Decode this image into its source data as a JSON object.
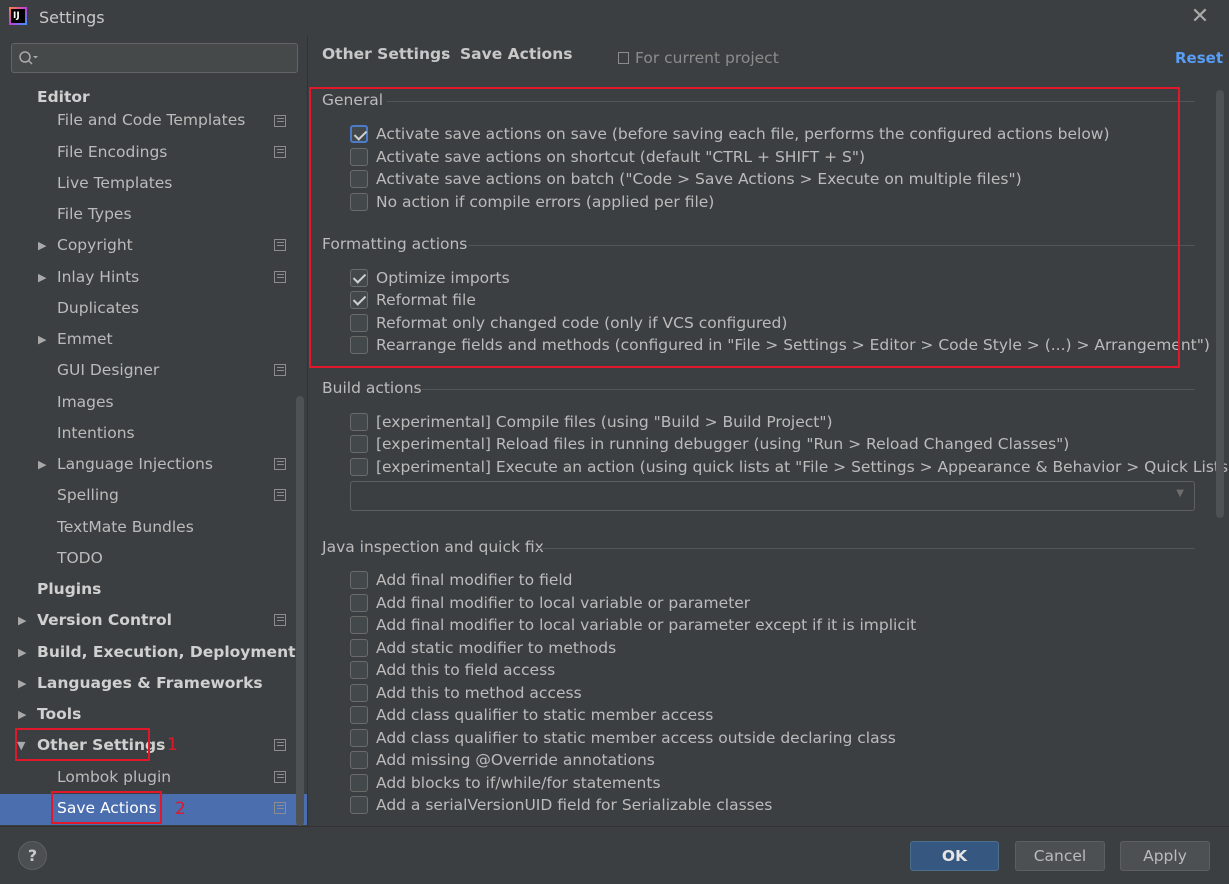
{
  "window": {
    "title": "Settings",
    "logo_text": "IJ"
  },
  "sidebar": {
    "items": [
      {
        "label": "Editor"
      },
      {
        "label": "File and Code Templates"
      },
      {
        "label": "File Encodings"
      },
      {
        "label": "Live Templates"
      },
      {
        "label": "File Types"
      },
      {
        "label": "Copyright"
      },
      {
        "label": "Inlay Hints"
      },
      {
        "label": "Duplicates"
      },
      {
        "label": "Emmet"
      },
      {
        "label": "GUI Designer"
      },
      {
        "label": "Images"
      },
      {
        "label": "Intentions"
      },
      {
        "label": "Language Injections"
      },
      {
        "label": "Spelling"
      },
      {
        "label": "TextMate Bundles"
      },
      {
        "label": "TODO"
      },
      {
        "label": "Plugins"
      },
      {
        "label": "Version Control"
      },
      {
        "label": "Build, Execution, Deployment"
      },
      {
        "label": "Languages & Frameworks"
      },
      {
        "label": "Tools"
      },
      {
        "label": "Other Settings"
      },
      {
        "label": "Lombok plugin"
      },
      {
        "label": "Save Actions"
      }
    ],
    "annotation_1": "1",
    "annotation_2": "2"
  },
  "header": {
    "breadcrumb_parent": "Other Settings",
    "breadcrumb_sep": "›",
    "breadcrumb_current": "Save Actions",
    "scope": "For current project",
    "reset": "Reset"
  },
  "general": {
    "title": "General",
    "options": [
      {
        "label": "Activate save actions on save (before saving each file, performs the configured actions below)",
        "checked": true
      },
      {
        "label": "Activate save actions on shortcut (default \"CTRL + SHIFT + S\")",
        "checked": false
      },
      {
        "label": "Activate save actions on batch (\"Code > Save Actions > Execute on multiple files\")",
        "checked": false
      },
      {
        "label": "No action if compile errors (applied per file)",
        "checked": false
      }
    ]
  },
  "formatting": {
    "title": "Formatting actions",
    "options": [
      {
        "label": "Optimize imports",
        "checked": true
      },
      {
        "label": "Reformat file",
        "checked": true
      },
      {
        "label": "Reformat only changed code (only if VCS configured)",
        "checked": false
      },
      {
        "label": "Rearrange fields and methods (configured in \"File > Settings > Editor > Code Style > (...) > Arrangement\")",
        "checked": false
      }
    ]
  },
  "build": {
    "title": "Build actions",
    "options": [
      {
        "label": "[experimental] Compile files (using \"Build > Build Project\")",
        "checked": false
      },
      {
        "label": "[experimental] Reload files in running debugger (using \"Run > Reload Changed Classes\")",
        "checked": false
      },
      {
        "label": "[experimental] Execute an action (using quick lists at \"File > Settings > Appearance & Behavior > Quick Lists\")",
        "checked": false
      }
    ],
    "combo_value": ""
  },
  "java": {
    "title": "Java inspection and quick fix",
    "options": [
      {
        "label": "Add final modifier to field",
        "checked": false
      },
      {
        "label": "Add final modifier to local variable or parameter",
        "checked": false
      },
      {
        "label": "Add final modifier to local variable or parameter except if it is implicit",
        "checked": false
      },
      {
        "label": "Add static modifier to methods",
        "checked": false
      },
      {
        "label": "Add this to field access",
        "checked": false
      },
      {
        "label": "Add this to method access",
        "checked": false
      },
      {
        "label": "Add class qualifier to static member access",
        "checked": false
      },
      {
        "label": "Add class qualifier to static member access outside declaring class",
        "checked": false
      },
      {
        "label": "Add missing @Override annotations",
        "checked": false
      },
      {
        "label": "Add blocks to if/while/for statements",
        "checked": false
      },
      {
        "label": "Add a serialVersionUID field for Serializable classes",
        "checked": false
      }
    ]
  },
  "footer": {
    "help": "?",
    "ok": "OK",
    "cancel": "Cancel",
    "apply": "Apply"
  },
  "colors": {
    "background": "#3c3f41",
    "selection": "#4b6eaf",
    "accent_link": "#589df6",
    "annotation_red": "#e0182b",
    "primary_button": "#365880"
  }
}
